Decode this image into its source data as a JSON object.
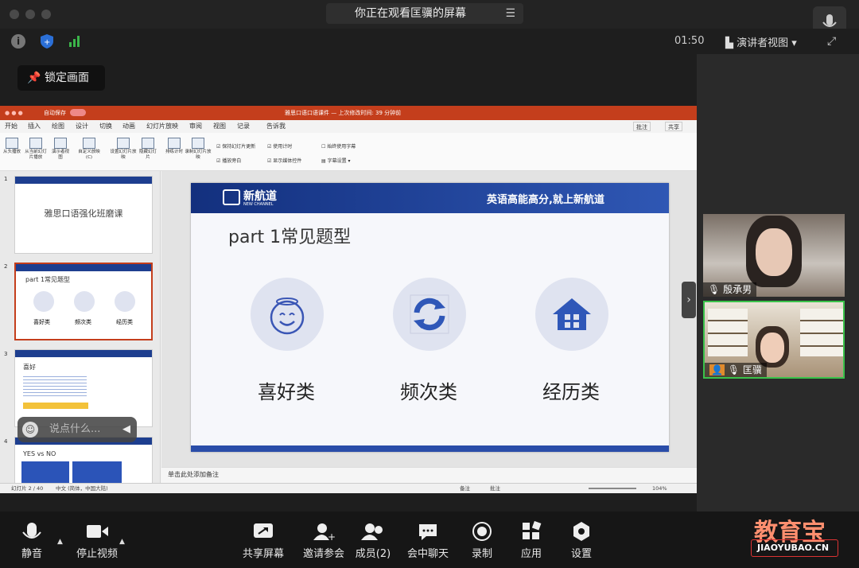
{
  "window": {
    "share_title": "你正在观看匡骥的屏幕",
    "timer": "01:50",
    "speaker_view": "演讲者视图",
    "lock_screen": "锁定画面"
  },
  "ppt": {
    "autosave": "自动保存",
    "file_title": "雅思口语口语课件 — 上次修改时间: 39 分钟前",
    "tabs": [
      "开始",
      "插入",
      "绘图",
      "设计",
      "切换",
      "动画",
      "幻灯片放映",
      "审阅",
      "视图",
      "记录",
      "告诉我"
    ],
    "active_tab": "幻灯片放映",
    "comment": "批注",
    "share": "共享",
    "ribbon": [
      "从头播放",
      "从当前幻灯片播放",
      "演示者视图",
      "自定义放映 (C)",
      "设置幻灯片放映",
      "隐藏幻灯片",
      "排练计时",
      "录制幻灯片放映"
    ],
    "checks": [
      "保持幻灯片更新",
      "使用计时",
      "始终使用字幕",
      "播放旁白",
      "显示媒体控件",
      "字幕设置"
    ],
    "thumbs": [
      {
        "num": "1",
        "title": "雅思口语强化班磨课"
      },
      {
        "num": "2",
        "title": "part 1常见题型",
        "items": [
          "喜好类",
          "频次类",
          "经历类"
        ]
      },
      {
        "num": "3",
        "title": "喜好"
      },
      {
        "num": "4",
        "title": "YES vs NO"
      }
    ],
    "slide": {
      "logo": "新航道",
      "logo_sub": "NEW CHANNEL",
      "slogan": "英语高能高分,就上新航道",
      "title": "part 1常见题型",
      "categories": [
        "喜好类",
        "频次类",
        "经历类"
      ]
    },
    "notes": "单击此处添加备注",
    "status": {
      "slide": "幻灯片 2 / 40",
      "lang": "中文 (简体，中国大陆)",
      "notes": "备注",
      "comments": "批注",
      "zoom": "104%"
    }
  },
  "chat_placeholder": "说点什么...",
  "participants": [
    {
      "name": "殷承男"
    },
    {
      "name": "匡骥"
    }
  ],
  "toolbar": {
    "mute": "静音",
    "video": "停止视频",
    "share": "共享屏幕",
    "invite": "邀请参会",
    "members": "成员(2)",
    "chat": "会中聊天",
    "record": "录制",
    "apps": "应用",
    "settings": "设置"
  },
  "watermark": {
    "title": "教育宝",
    "url": "JIAOYUBAO.CN"
  }
}
